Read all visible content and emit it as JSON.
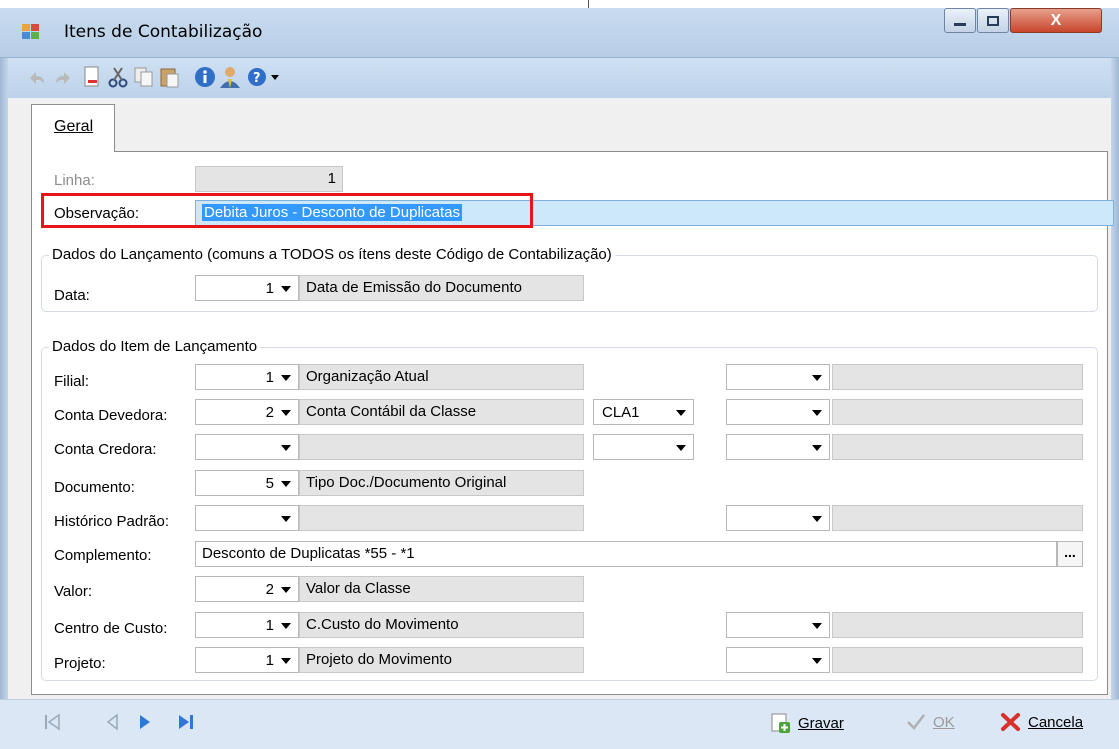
{
  "window": {
    "title": "Itens de Contabilização",
    "minimize": "minimize",
    "maximize": "maximize",
    "close": "X"
  },
  "tabs": [
    {
      "label": "Geral"
    }
  ],
  "form": {
    "linha_label": "Linha:",
    "linha_value": "1",
    "observacao_label": "Observação:",
    "observacao_value": "Debita Juros - Desconto de Duplicatas"
  },
  "group_lancamento": {
    "title": "Dados do Lançamento (comuns a TODOS os ítens deste Código de Contabilização)",
    "data_label": "Data:",
    "data_code": "1",
    "data_desc": "Data de Emissão do Documento"
  },
  "group_item": {
    "title": "Dados do Item de Lançamento",
    "rows": [
      {
        "label": "Filial:",
        "code": "1",
        "desc": "Organização Atual"
      },
      {
        "label": "Conta Devedora:",
        "code": "2",
        "desc": "Conta Contábil da Classe",
        "extra": "CLA1"
      },
      {
        "label": "Conta Credora:",
        "code": "",
        "desc": ""
      },
      {
        "label": "Documento:",
        "code": "5",
        "desc": "Tipo Doc./Documento Original"
      },
      {
        "label": "Histórico Padrão:",
        "code": "",
        "desc": ""
      },
      {
        "label": "Complemento:",
        "value": "Desconto de Duplicatas *55 - *1",
        "button": "..."
      },
      {
        "label": "Valor:",
        "code": "2",
        "desc": "Valor da Classe"
      },
      {
        "label": "Centro de Custo:",
        "code": "1",
        "desc": "C.Custo do Movimento"
      },
      {
        "label": "Projeto:",
        "code": "1",
        "desc": "Projeto do Movimento"
      }
    ]
  },
  "footer": {
    "gravar": "Gravar",
    "ok": "OK",
    "cancelar": "Cancela"
  },
  "colors": {
    "highlight_border": "#e4161c",
    "selection": "#3399ff"
  }
}
